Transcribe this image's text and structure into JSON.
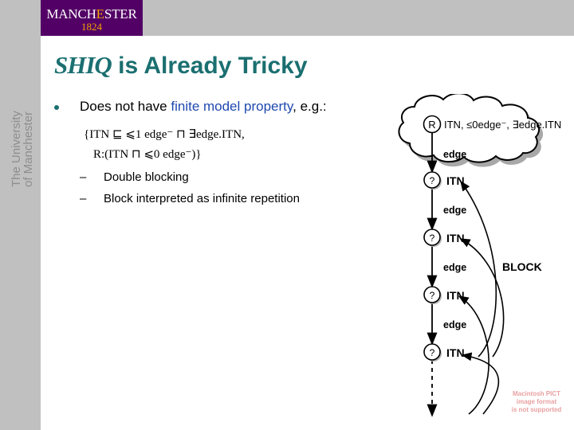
{
  "branding": {
    "vertical_wordmark": "The University\nof Manchester",
    "logo_word_pre": "MANCH",
    "logo_word_hl": "E",
    "logo_word_post": "STER",
    "logo_year": "1824",
    "purple": "#530066",
    "gold": "#f0a000",
    "grey": "#c0c0c0"
  },
  "slide": {
    "title_logic": "SHIQ",
    "title_rest": " is Already Tricky",
    "title_color": "#1b6f70",
    "bullet": {
      "text_before": "Does not have ",
      "text_emphasis": "finite model property",
      "text_after": ", e.g.:",
      "emphasis_color": "#1f49b0"
    },
    "formula_line1": "{ITN ⊑ ⩽1 edge⁻ ⊓ ∃edge.ITN,",
    "formula_line2": "R:(ITN ⊓ ⩽0 edge⁻)}",
    "sub_bullets": [
      {
        "dash": "–",
        "label": "Double blocking"
      },
      {
        "dash": "–",
        "label": "Block interpreted as infinite repetition"
      }
    ]
  },
  "diagram": {
    "root_node_label": "R",
    "cloud_label": "ITN, ≤0edge⁻, ∃edge.ITN",
    "node_label": "?",
    "node_concept": "ITN",
    "edge_label": "edge",
    "block_label": "BLOCK",
    "nodes": [
      {
        "concept": "ITN"
      },
      {
        "concept": "ITN"
      },
      {
        "concept": "ITN"
      },
      {
        "concept": "ITN"
      }
    ],
    "edges": [
      {
        "label": "edge"
      },
      {
        "label": "edge"
      },
      {
        "label": "edge"
      },
      {
        "label": "edge"
      }
    ]
  },
  "pict_placeholder": {
    "line1": "Macintosh PICT",
    "line2": "image format",
    "line3": "is not supported",
    "color": "#e9a0a0"
  }
}
